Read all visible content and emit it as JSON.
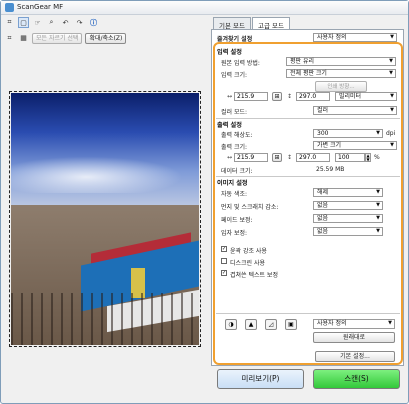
{
  "window": {
    "title": "ScanGear MF"
  },
  "toolbar": {
    "auto_crop_label": "모든 자르기 선택",
    "zoom_label": "확대/축소(Z)"
  },
  "tabs": [
    {
      "label": "기본 모드"
    },
    {
      "label": "고급 모드"
    }
  ],
  "favorites": {
    "label": "즐겨찾기 설정",
    "value": "사용자 정의"
  },
  "input_settings": {
    "title": "입력 설정",
    "input_method_label": "원본 입력 방법:",
    "input_method_value": "평판 유리",
    "input_size_label": "입력 크기:",
    "input_size_value": "전체 평판 크기",
    "width_value": "215.9",
    "height_value": "297.0",
    "unit_value": "밀리미터",
    "color_mode_label": "컬러 모드:",
    "color_mode_value": "컬러",
    "icon_w": "↔",
    "icon_h": "↕"
  },
  "output_settings": {
    "title": "출력 설정",
    "resolution_label": "출력 해상도:",
    "resolution_value": "300",
    "resolution_unit": "dpi",
    "output_size_label": "출력 크기:",
    "output_size_value": "가변 크기",
    "out_width": "215.9",
    "out_height": "297.0",
    "scale_value": "100",
    "scale_unit": "%",
    "data_size_label": "데이터 크기:",
    "data_size_value": "25.59 MB"
  },
  "image_settings": {
    "title": "이미지 설정",
    "auto_tone_label": "자동 색조:",
    "auto_tone_value": "해제",
    "dust_label": "먼지 및 스크래치 감소:",
    "dust_value": "없음",
    "fade_label": "페이드 보정:",
    "fade_value": "없음",
    "grain_label": "입자 보정:",
    "grain_value": "없음",
    "checks": [
      {
        "label": "윤곽 강조 사용",
        "checked": true
      },
      {
        "label": "디스크린 사용",
        "checked": false
      },
      {
        "label": "겹쳐쓴 텍스트 보정",
        "checked": true
      }
    ]
  },
  "adjust": {
    "custom_value": "사용자 정의",
    "reset_label": "원래대로"
  },
  "preferences_label": "기본 설정...",
  "preview_button": "미리보기(P)",
  "scan_button": "스캔(S)",
  "colors": {
    "highlight": "#f0a030",
    "scan_green": "#3fd94a",
    "preview_blue": "#cfe3f7"
  }
}
